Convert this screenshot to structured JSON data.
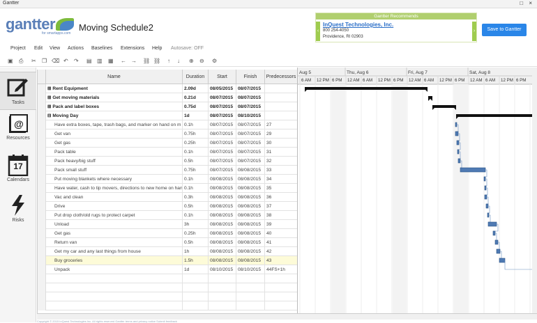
{
  "window": {
    "title": "Gantter",
    "controls": "□ ×"
  },
  "app": {
    "logo": "gantter",
    "logo_sub": "for smartapps.com",
    "project_title": "Moving Schedule2",
    "save_label": "Save to Gantter"
  },
  "ad": {
    "header": "Gantter Recommends",
    "company": "InQuest Technologies, Inc.",
    "phone": "800 254-4050",
    "city": "Providence, RI 02903"
  },
  "menu": [
    "Project",
    "Edit",
    "View",
    "Actions",
    "Baselines",
    "Extensions",
    "Help",
    "Autosave: OFF"
  ],
  "sidebar": [
    {
      "label": "Tasks",
      "icon": "edit-icon"
    },
    {
      "label": "Resources",
      "icon": "at-icon"
    },
    {
      "label": "Calendars",
      "icon": "calendar-icon",
      "day": "17"
    },
    {
      "label": "Risks",
      "icon": "lightning-icon"
    }
  ],
  "columns": [
    "Name",
    "Duration",
    "Start",
    "Finish",
    "Predecessors"
  ],
  "tasks": [
    {
      "name": "Rent Equipment",
      "duration": "2.09d",
      "start": "08/05/2015",
      "finish": "08/07/2015",
      "pred": "",
      "summary": true
    },
    {
      "name": "Get moving materials",
      "duration": "0.21d",
      "start": "08/07/2015",
      "finish": "08/07/2015",
      "pred": "",
      "summary": true
    },
    {
      "name": "Pack and label boxes",
      "duration": "0.75d",
      "start": "08/07/2015",
      "finish": "08/07/2015",
      "pred": "",
      "summary": true
    },
    {
      "name": "Moving Day",
      "duration": "1d",
      "start": "08/07/2015",
      "finish": "08/10/2015",
      "pred": "",
      "summary": true
    },
    {
      "name": "Have extra boxes, tape, trash bags, and marker on hand on m",
      "duration": "0.1h",
      "start": "08/07/2015",
      "finish": "08/07/2015",
      "pred": "27"
    },
    {
      "name": "Get van",
      "duration": "0.75h",
      "start": "08/07/2015",
      "finish": "08/07/2015",
      "pred": "29"
    },
    {
      "name": "Get gas",
      "duration": "0.25h",
      "start": "08/07/2015",
      "finish": "08/07/2015",
      "pred": "30"
    },
    {
      "name": "Pack table",
      "duration": "0.1h",
      "start": "08/07/2015",
      "finish": "08/07/2015",
      "pred": "31"
    },
    {
      "name": "Pack heavy/big stuff",
      "duration": "0.5h",
      "start": "08/07/2015",
      "finish": "08/07/2015",
      "pred": "32"
    },
    {
      "name": "Pack small stuff",
      "duration": "0.75h",
      "start": "08/07/2015",
      "finish": "08/08/2015",
      "pred": "33"
    },
    {
      "name": "Put moving blankets where necessary",
      "duration": "0.1h",
      "start": "08/08/2015",
      "finish": "08/08/2015",
      "pred": "34"
    },
    {
      "name": "Have water, cash to tip movers, directions to new home on han",
      "duration": "0.1h",
      "start": "08/08/2015",
      "finish": "08/08/2015",
      "pred": "35"
    },
    {
      "name": "Vac and clean",
      "duration": "0.3h",
      "start": "08/08/2015",
      "finish": "08/08/2015",
      "pred": "36"
    },
    {
      "name": "Drive",
      "duration": "0.5h",
      "start": "08/08/2015",
      "finish": "08/08/2015",
      "pred": "37"
    },
    {
      "name": "Put drop cloth/old rugs to protect carpet",
      "duration": "0.1h",
      "start": "08/08/2015",
      "finish": "08/08/2015",
      "pred": "38"
    },
    {
      "name": "Unload",
      "duration": "3h",
      "start": "08/08/2015",
      "finish": "08/08/2015",
      "pred": "39"
    },
    {
      "name": "Get gas",
      "duration": "0.25h",
      "start": "08/08/2015",
      "finish": "08/08/2015",
      "pred": "40"
    },
    {
      "name": "Return van",
      "duration": "0.5h",
      "start": "08/08/2015",
      "finish": "08/08/2015",
      "pred": "41"
    },
    {
      "name": "Get my car and any last things from house",
      "duration": "1h",
      "start": "08/08/2015",
      "finish": "08/08/2015",
      "pred": "42"
    },
    {
      "name": "Buy groceries",
      "duration": "1.5h",
      "start": "08/08/2015",
      "finish": "08/08/2015",
      "pred": "43",
      "selected": true
    },
    {
      "name": "Unpack",
      "duration": "1d",
      "start": "08/10/2015",
      "finish": "08/10/2015",
      "pred": "44FS+1h"
    }
  ],
  "gantt": {
    "days": [
      "Aug 5",
      "Thu, Aug 6",
      "Fri, Aug 7",
      "Sat, Aug 8"
    ],
    "hours": [
      "6 AM",
      "12 PM",
      "6 PM",
      "12 AM",
      "6 AM",
      "12 PM",
      "6 PM",
      "12 AM",
      "6 AM",
      "12 PM",
      "6 PM",
      "12 AM",
      "6 AM",
      "12 PM",
      "6 PM"
    ]
  },
  "footer_text": "Copyright © 2015  InQuest Technologies Inc.  All rights reserved  Gantter terms and privacy notice  Submit feedback"
}
